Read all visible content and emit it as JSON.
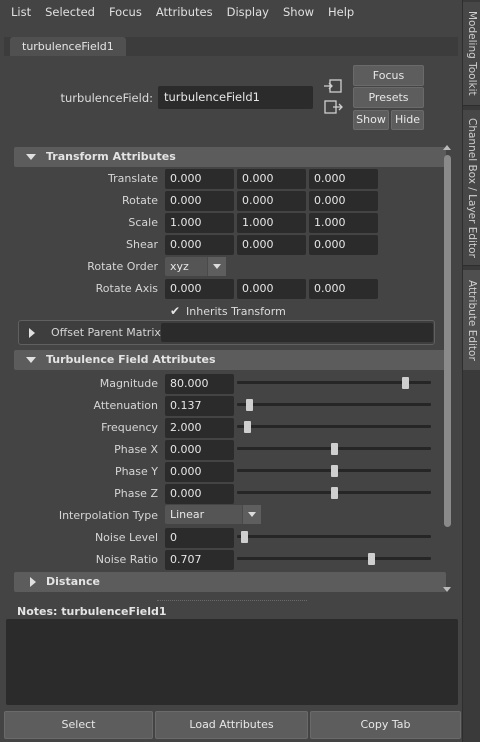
{
  "menu": [
    "List",
    "Selected",
    "Focus",
    "Attributes",
    "Display",
    "Show",
    "Help"
  ],
  "side_tabs": [
    "Modeling Toolkit",
    "Channel Box / Layer Editor",
    "Attribute Editor"
  ],
  "node_tab": "turbulenceField1",
  "header": {
    "field_label": "turbulenceField:",
    "field_value": "turbulenceField1",
    "focus_label": "Focus",
    "presets_label": "Presets",
    "show_label": "Show",
    "hide_label": "Hide"
  },
  "transform": {
    "title": "Transform Attributes",
    "rows": [
      {
        "label": "Translate",
        "values": [
          "0.000",
          "0.000",
          "0.000"
        ]
      },
      {
        "label": "Rotate",
        "values": [
          "0.000",
          "0.000",
          "0.000"
        ]
      },
      {
        "label": "Scale",
        "values": [
          "1.000",
          "1.000",
          "1.000"
        ]
      },
      {
        "label": "Shear",
        "values": [
          "0.000",
          "0.000",
          "0.000"
        ]
      }
    ],
    "rotate_order_label": "Rotate Order",
    "rotate_order_value": "xyz",
    "rotate_axis_label": "Rotate Axis",
    "rotate_axis_values": [
      "0.000",
      "0.000",
      "0.000"
    ],
    "inherits_label": "Inherits Transform",
    "inherits_checked": true,
    "offset_parent_label": "Offset Parent Matrix"
  },
  "turbulence": {
    "title": "Turbulence Field Attributes",
    "magnitude": {
      "label": "Magnitude",
      "value": "80.000",
      "slider": 0.88
    },
    "attenuation": {
      "label": "Attenuation",
      "value": "0.137",
      "slider": 0.05
    },
    "frequency": {
      "label": "Frequency",
      "value": "2.000",
      "slider": 0.04
    },
    "phase_x": {
      "label": "Phase X",
      "value": "0.000",
      "slider": 0.5
    },
    "phase_y": {
      "label": "Phase Y",
      "value": "0.000",
      "slider": 0.5
    },
    "phase_z": {
      "label": "Phase Z",
      "value": "0.000",
      "slider": 0.5
    },
    "interpolation_label": "Interpolation Type",
    "interpolation_value": "Linear",
    "noise_level": {
      "label": "Noise Level",
      "value": "0",
      "slider": 0.02
    },
    "noise_ratio": {
      "label": "Noise Ratio",
      "value": "0.707",
      "slider": 0.7
    }
  },
  "distance_title": "Distance",
  "notes_label": "Notes:  turbulenceField1",
  "bottom": {
    "select_label": "Select",
    "load_label": "Load Attributes",
    "copy_label": "Copy Tab"
  },
  "colors": {
    "background": "#444444",
    "field": "#2b2b2b",
    "section_header": "#5c5c5c",
    "button": "#5d5d5d"
  }
}
